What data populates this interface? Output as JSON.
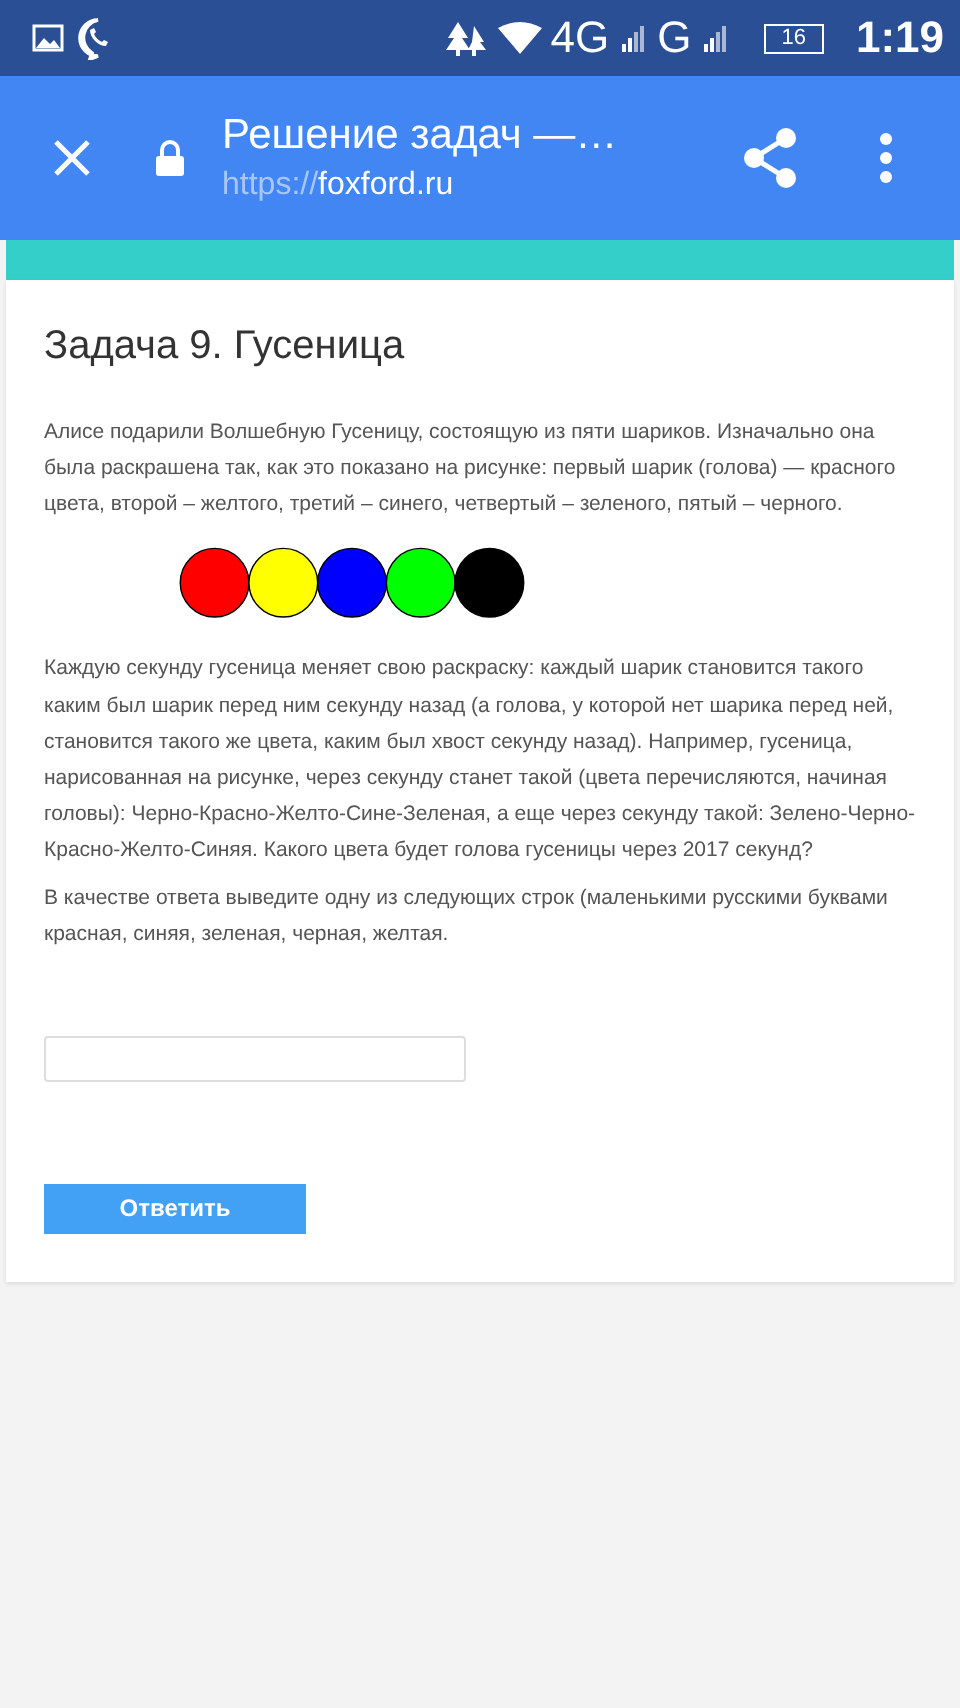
{
  "status_bar": {
    "network": "4G",
    "network_2": "G",
    "battery": "16",
    "time": "1:19"
  },
  "toolbar": {
    "title": "Решение задач —…",
    "url_scheme": "https://",
    "url_host": "foxford.ru"
  },
  "task": {
    "title": "Задача 9. Гусеница",
    "paragraphs": [
      [
        "Алисе подарили Волшебную Гусеницу, состоящую из пяти шариков. Изначально она",
        "была раскрашена так, как это показано на рисунке: первый шарик (голова) — красного",
        "цвета, второй – желтого, третий – синего, четвертый – зеленого, пятый – черного."
      ],
      [
        "Каждую секунду гусеница меняет свою раскраску: каждый шарик становится такого",
        "каким был шарик перед ним секунду назад (а голова, у которой нет шарика перед ней,",
        "становится такого же цвета, каким был хвост секунду назад). Например, гусеница,",
        "нарисованная на рисунке, через секунду станет такой (цвета перечисляются, начиная",
        "головы): Черно-Красно-Желто-Сине-Зеленая, а еще через секунду такой: Зелено-Черно-",
        "Красно-Желто-Синяя. Какого цвета будет голова гусеницы через 2017 секунд?"
      ],
      [
        "В качестве ответа выведите одну из следующих строк (маленькими русскими буквами",
        "красная, синяя, зеленая, черная, желтая."
      ]
    ],
    "balls": [
      {
        "color": "#ff0000"
      },
      {
        "color": "#ffff00"
      },
      {
        "color": "#0000ff"
      },
      {
        "color": "#00ff00"
      },
      {
        "color": "#000000"
      }
    ],
    "submit": "Ответить"
  }
}
